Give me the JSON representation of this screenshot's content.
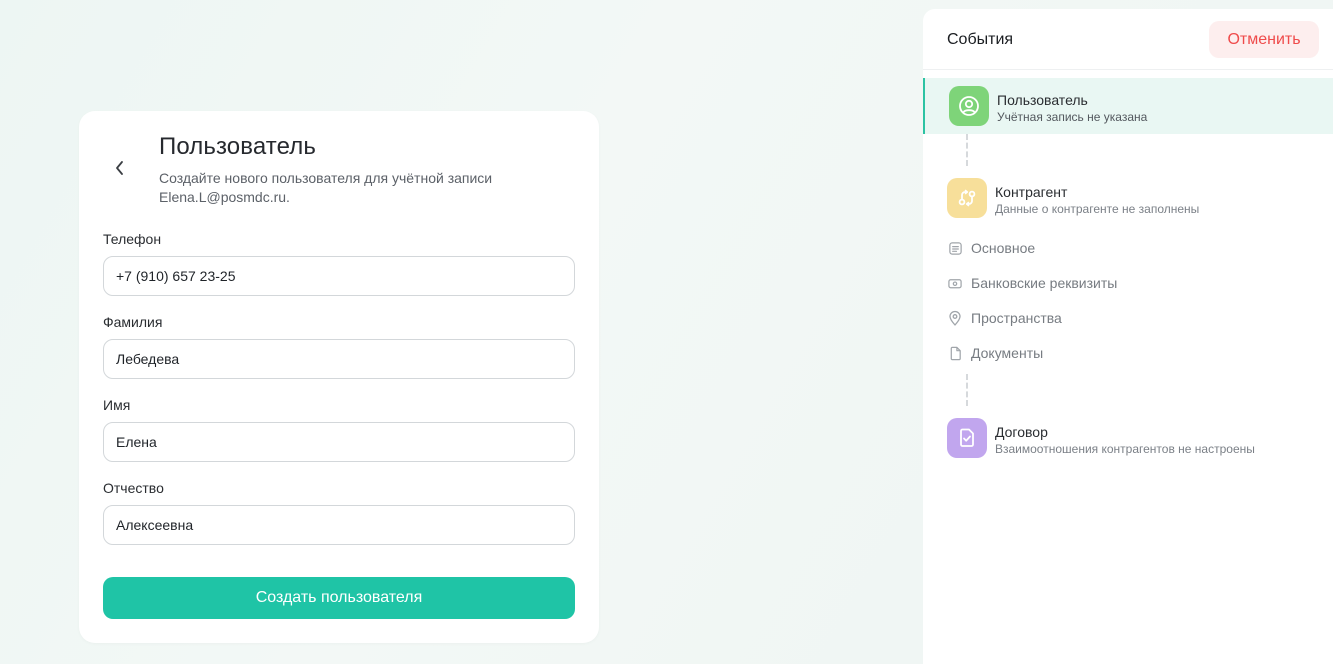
{
  "form": {
    "title": "Пользователь",
    "subtitle": "Создайте нового пользователя для учётной записи Elena.L@posmdc.ru.",
    "fields": [
      {
        "label": "Телефон",
        "value": "+7 (910) 657 23-25"
      },
      {
        "label": "Фамилия",
        "value": "Лебедева"
      },
      {
        "label": "Имя",
        "value": "Елена"
      },
      {
        "label": "Отчество",
        "value": "Алексеевна"
      }
    ],
    "submit_label": "Создать пользователя"
  },
  "panel": {
    "title": "События",
    "cancel_label": "Отменить",
    "steps": [
      {
        "title": "Пользователь",
        "desc": "Учётная запись не указана",
        "icon": "user-icon",
        "color": "#7ed479",
        "active": true
      },
      {
        "title": "Контрагент",
        "desc": "Данные о контрагенте не заполнены",
        "icon": "exchange-icon",
        "color": "#f7df9a",
        "active": false
      },
      {
        "title": "Договор",
        "desc": "Взаимоотношения контрагентов не настроены",
        "icon": "contract-icon",
        "color": "#c1a6ee",
        "active": false
      }
    ],
    "sub_items": [
      {
        "label": "Основное",
        "icon": "document-lines-icon"
      },
      {
        "label": "Банковские реквизиты",
        "icon": "banknote-icon"
      },
      {
        "label": "Пространства",
        "icon": "location-pin-icon"
      },
      {
        "label": "Документы",
        "icon": "file-icon"
      }
    ]
  },
  "colors": {
    "accent": "#1fc4a6",
    "cancel_text": "#ef4b4b",
    "cancel_bg": "#fdeeee",
    "active_step_bg": "#e9f7f3"
  }
}
